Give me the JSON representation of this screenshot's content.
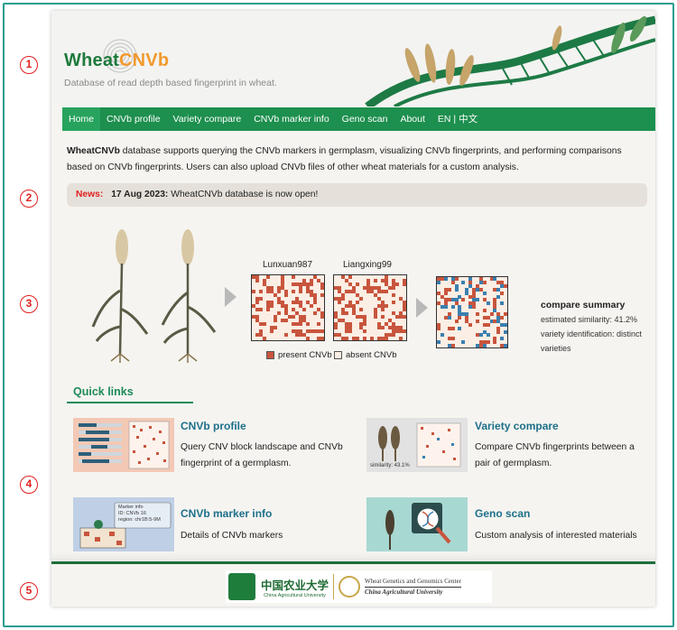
{
  "callouts": [
    "1",
    "2",
    "3",
    "4",
    "5"
  ],
  "header": {
    "logo_main": "Wheat",
    "logo_accent": "CNVb",
    "tagline": "Database of read depth based fingerprint in wheat."
  },
  "nav": {
    "items": [
      {
        "label": "Home",
        "active": true
      },
      {
        "label": "CNVb profile"
      },
      {
        "label": "Variety compare"
      },
      {
        "label": "CNVb marker info"
      },
      {
        "label": "Geno scan"
      },
      {
        "label": "About"
      },
      {
        "label": "EN | 中文"
      }
    ]
  },
  "intro": {
    "name": "WheatCNVb",
    "text": " database supports querying the CNVb markers in germplasm, visualizing CNVb fingerprints, and performing comparisons based on CNVb fingerprints. Users can also upload CNVb files of other wheat materials for a custom analysis."
  },
  "news": {
    "label": "News:",
    "date": "17 Aug 2023:",
    "text": "WheatCNVb database is now open!"
  },
  "demo": {
    "variety_a": "Lunxuan987",
    "variety_b": "Liangxing99",
    "legend_present": "present CNVb",
    "legend_absent": "absent CNVb",
    "summary_title": "compare summary",
    "summary_similarity": "estimated similarity: 41.2%",
    "summary_identification": "variety identification: distinct varieties",
    "colors": {
      "present": "#c8553d",
      "absent": "#fbeee4",
      "blue": "#3a7fb0"
    }
  },
  "quick_links": {
    "title": "Quick links",
    "cards": [
      {
        "title": "CNVb profile",
        "desc": "Query CNV block landscape and CNVb fingerprint of a germplasm."
      },
      {
        "title": "Variety compare",
        "desc": "Compare CNVb fingerprints between a pair of germplasm.",
        "img_label": "similarity: 43.1%"
      },
      {
        "title": "CNVb marker info",
        "desc": "Details of CNVb markers",
        "img_lines": [
          "Marker info",
          "ID: CNVb 16",
          "region: chr1B:5-9M"
        ]
      },
      {
        "title": "Geno scan",
        "desc": "Custom analysis of interested materials"
      }
    ]
  },
  "footer": {
    "cau_cn": "中国农业大学",
    "cau_en": "China Agricultural University",
    "wgg_a": "Wheat Genetics and Genomics Center",
    "wgg_b": "China Agricultural University"
  }
}
